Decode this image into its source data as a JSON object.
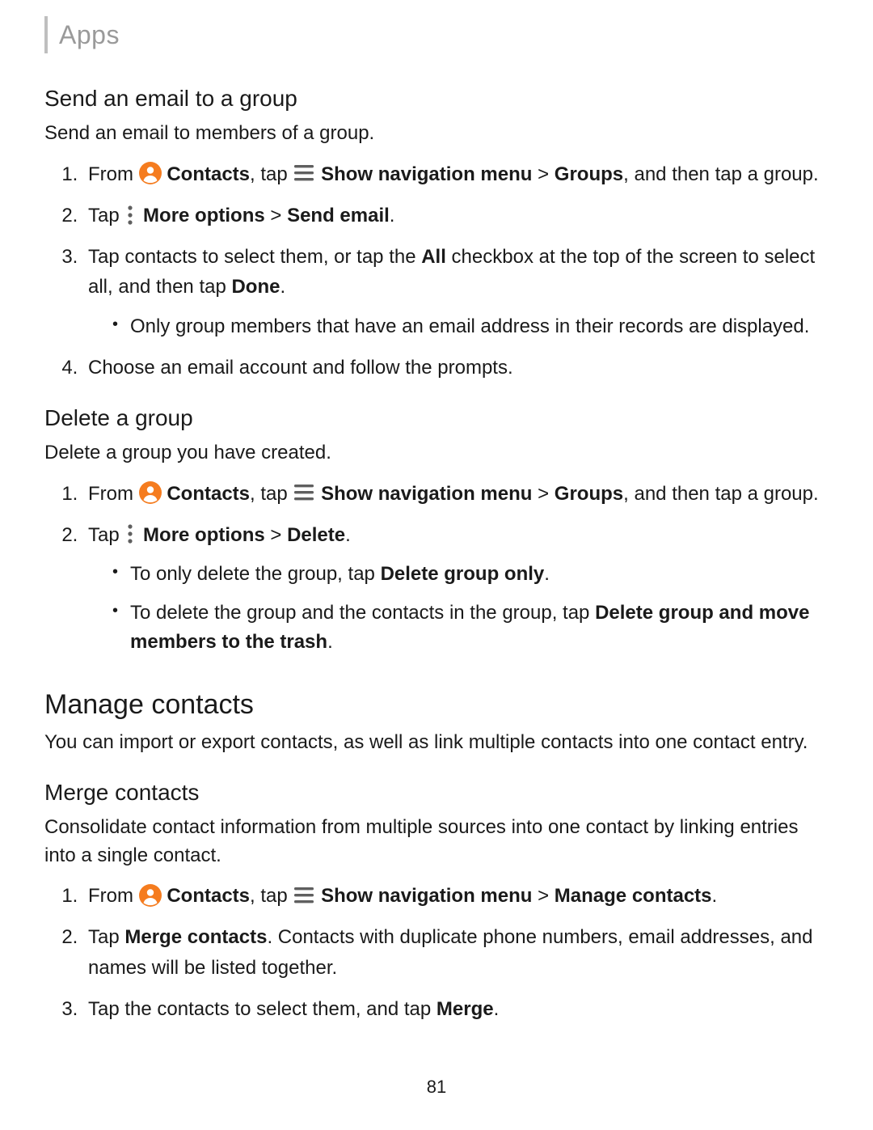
{
  "header": {
    "title": "Apps"
  },
  "pageNumber": "81",
  "labels": {
    "contacts": "Contacts",
    "showNav": "Show navigation menu",
    "groups": "Groups",
    "manageContacts": "Manage contacts",
    "moreOptions": "More options",
    "sendEmail": "Send email",
    "delete": "Delete",
    "all": "All",
    "done": "Done",
    "mergeContacts": "Merge contacts",
    "merge": "Merge",
    "deleteGroupOnly": "Delete group only",
    "deleteGroupMove": "Delete group and move members to the trash"
  },
  "sec1": {
    "title": "Send an email to a group",
    "intro": "Send an email to members of a group.",
    "s1a": "From ",
    "s1b": ", tap ",
    "s1c": " > ",
    "s1d": ", and then tap a group.",
    "s2a": "Tap ",
    "s2b": " > ",
    "s2c": ".",
    "s3a": "Tap contacts to select them, or tap the ",
    "s3b": " checkbox at the top of the screen to select all, and then tap ",
    "s3c": ".",
    "s3sub": "Only group members that have an email address in their records are displayed.",
    "s4": "Choose an email account and follow the prompts."
  },
  "sec2": {
    "title": "Delete a group",
    "intro": "Delete a group you have created.",
    "s1a": "From ",
    "s1b": ", tap ",
    "s1c": " > ",
    "s1d": ", and then tap a group.",
    "s2a": "Tap ",
    "s2b": " > ",
    "s2c": ".",
    "sub1a": "To only delete the group, tap ",
    "sub1b": ".",
    "sub2a": "To delete the group and the contacts in the group, tap ",
    "sub2b": "."
  },
  "sec3": {
    "title": "Manage contacts",
    "intro": "You can import or export contacts, as well as link multiple contacts into one contact entry."
  },
  "sec4": {
    "title": "Merge contacts",
    "intro": "Consolidate contact information from multiple sources into one contact by linking entries into a single contact.",
    "s1a": "From ",
    "s1b": ", tap ",
    "s1c": " > ",
    "s1d": ".",
    "s2a": "Tap ",
    "s2b": ". Contacts with duplicate phone numbers, email addresses, and names will be listed together.",
    "s3a": "Tap the contacts to select them, and tap ",
    "s3b": "."
  }
}
